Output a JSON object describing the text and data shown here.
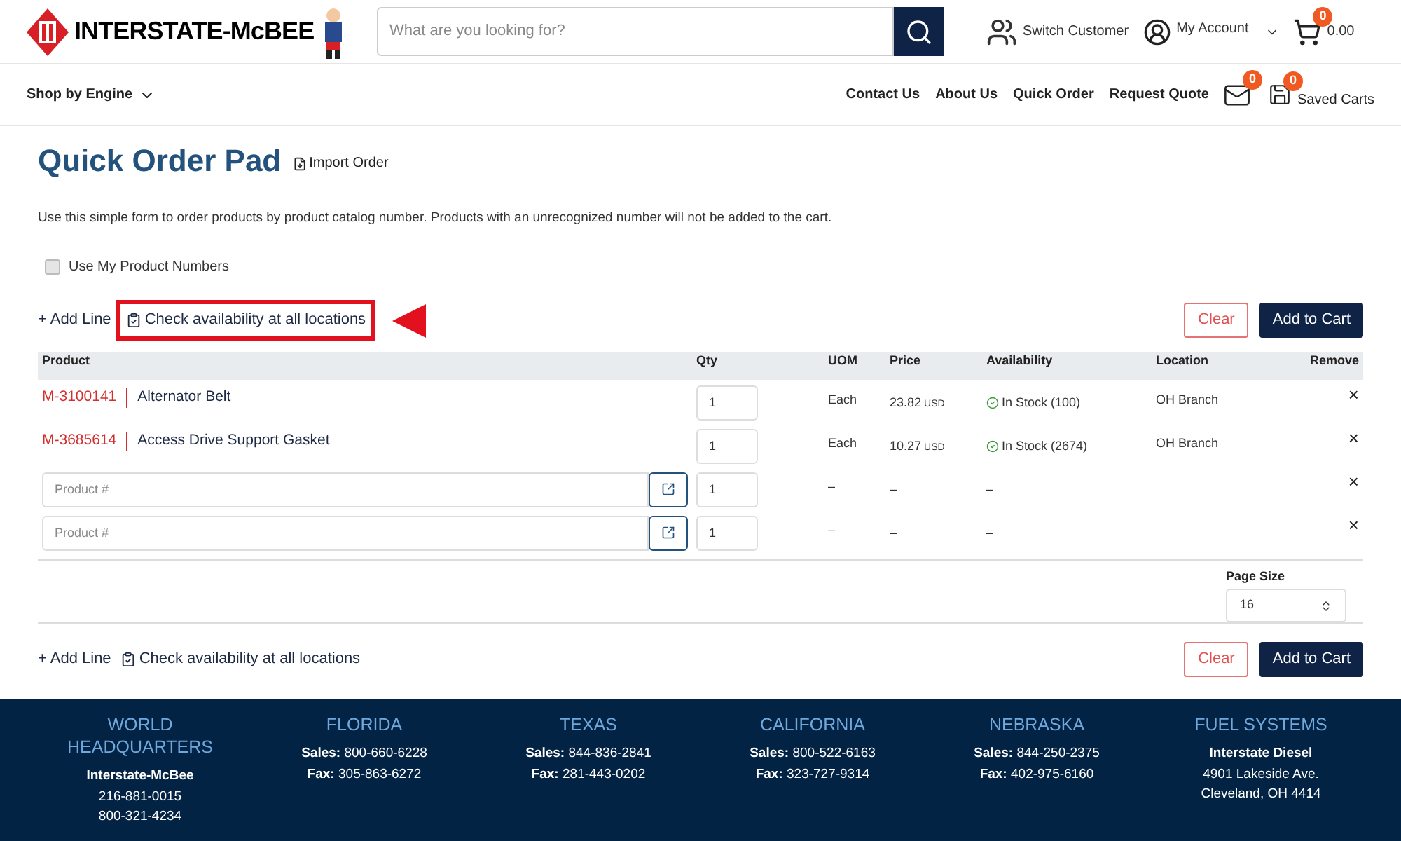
{
  "header": {
    "logo_text": "INTERSTATE-McBEE",
    "search": {
      "placeholder": "What are you looking for?"
    },
    "switch_customer": "Switch Customer",
    "account": "My Account",
    "cart_count": "0",
    "cart_total": "0.00"
  },
  "nav": {
    "shop_by": "Shop by Engine",
    "links": [
      "Contact Us",
      "About Us",
      "Quick Order",
      "Request Quote"
    ],
    "messages_count": "0",
    "saved_carts_count": "0",
    "saved_carts": "Saved Carts"
  },
  "page": {
    "title": "Quick Order Pad",
    "import": "Import Order",
    "intro": "Use this simple form to order products by product catalog number. Products with an unrecognized number will not be added to the cart.",
    "use_my_numbers": {
      "label": "Use My Product Numbers",
      "checked": false
    }
  },
  "toolbar_top": {
    "add_line": "+ Add Line",
    "check": "Check availability at all locations",
    "highlighted": true,
    "clear": "Clear",
    "add_to_cart": "Add to Cart"
  },
  "table": {
    "columns": [
      "Product",
      "Qty",
      "UOM",
      "Price",
      "Availability",
      "Location",
      "Remove"
    ],
    "rows": [
      {
        "kind": "item",
        "number": "M-3100141",
        "name": "Alternator Belt",
        "qty": "1",
        "uom": "Each",
        "price": "23.82",
        "currency": "USD",
        "availability": "In Stock (100)",
        "location": "OH Branch",
        "remove": "×"
      },
      {
        "kind": "item",
        "number": "M-3685614",
        "name": "Access Drive Support Gasket",
        "qty": "1",
        "uom": "Each",
        "price": "10.27",
        "currency": "USD",
        "availability": "In Stock (2674)",
        "location": "OH Branch",
        "remove": "×"
      },
      {
        "kind": "entry",
        "placeholder": "Product #",
        "qty": "1",
        "uom": "–",
        "price": "–",
        "availability": "–",
        "remove": "×"
      },
      {
        "kind": "entry",
        "placeholder": "Product #",
        "qty": "1",
        "uom": "–",
        "price": "–",
        "availability": "–",
        "remove": "×"
      }
    ]
  },
  "page_size": {
    "label": "Page Size",
    "value": "16"
  },
  "toolbar_bottom": {
    "add_line": "+ Add Line",
    "check": "Check availability at all locations",
    "clear": "Clear",
    "add_to_cart": "Add to Cart"
  },
  "footer": [
    {
      "title": "WORLD HEADQUARTERS",
      "lines": [
        "**Interstate-McBee**",
        "216-881-0015",
        "800-321-4234"
      ]
    },
    {
      "title": "FLORIDA",
      "lines": [
        "**Sales:** 800-660-6228",
        "**Fax:** 305-863-6272"
      ]
    },
    {
      "title": "TEXAS",
      "lines": [
        "**Sales:** 844-836-2841",
        "**Fax:** 281-443-0202"
      ]
    },
    {
      "title": "CALIFORNIA",
      "lines": [
        "**Sales:** 800-522-6163",
        "**Fax:** 323-727-9314"
      ]
    },
    {
      "title": "NEBRASKA",
      "lines": [
        "**Sales:** 844-250-2375",
        "**Fax:** 402-975-6160"
      ]
    },
    {
      "title": "FUEL SYSTEMS",
      "lines": [
        "**Interstate Diesel**",
        "4901 Lakeside Ave.",
        "Cleveland, OH 4414"
      ]
    }
  ]
}
